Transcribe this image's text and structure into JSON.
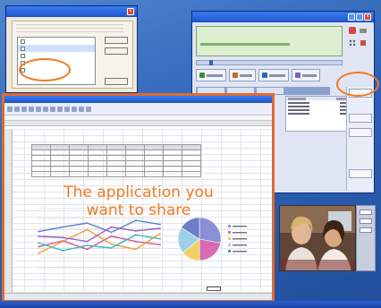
{
  "caption": {
    "line1": "The application you",
    "line2": "want to share"
  },
  "share_dialog": {
    "close_label": "×",
    "colors": {
      "highlight_ring": "#f07a22"
    }
  },
  "conference": {
    "close_label": "×"
  },
  "chart_data": {
    "type": "line",
    "series": [
      {
        "color": "#5b7fd6",
        "values": [
          55,
          62,
          68,
          54,
          72,
          66
        ]
      },
      {
        "color": "#d0569a",
        "values": [
          32,
          41,
          28,
          48,
          40,
          35
        ]
      },
      {
        "color": "#f0a03a",
        "values": [
          22,
          40,
          58,
          36,
          28,
          52
        ]
      },
      {
        "color": "#3cb7c6",
        "values": [
          38,
          26,
          34,
          30,
          50,
          44
        ]
      },
      {
        "color": "#9a60c8",
        "values": [
          48,
          46,
          40,
          62,
          56,
          60
        ]
      }
    ],
    "ylim": [
      0,
      90
    ],
    "grid": true
  },
  "pie_data": {
    "type": "pie",
    "values": [
      28,
      22,
      14,
      20,
      16
    ],
    "colors": [
      "#8a8fd6",
      "#d86bb0",
      "#f0d060",
      "#9dd0e8",
      "#6c7ec8"
    ]
  },
  "colors": {
    "desktop": "#2f63b8",
    "accent": "#f07a22",
    "excel_border": "#e06a2c"
  }
}
